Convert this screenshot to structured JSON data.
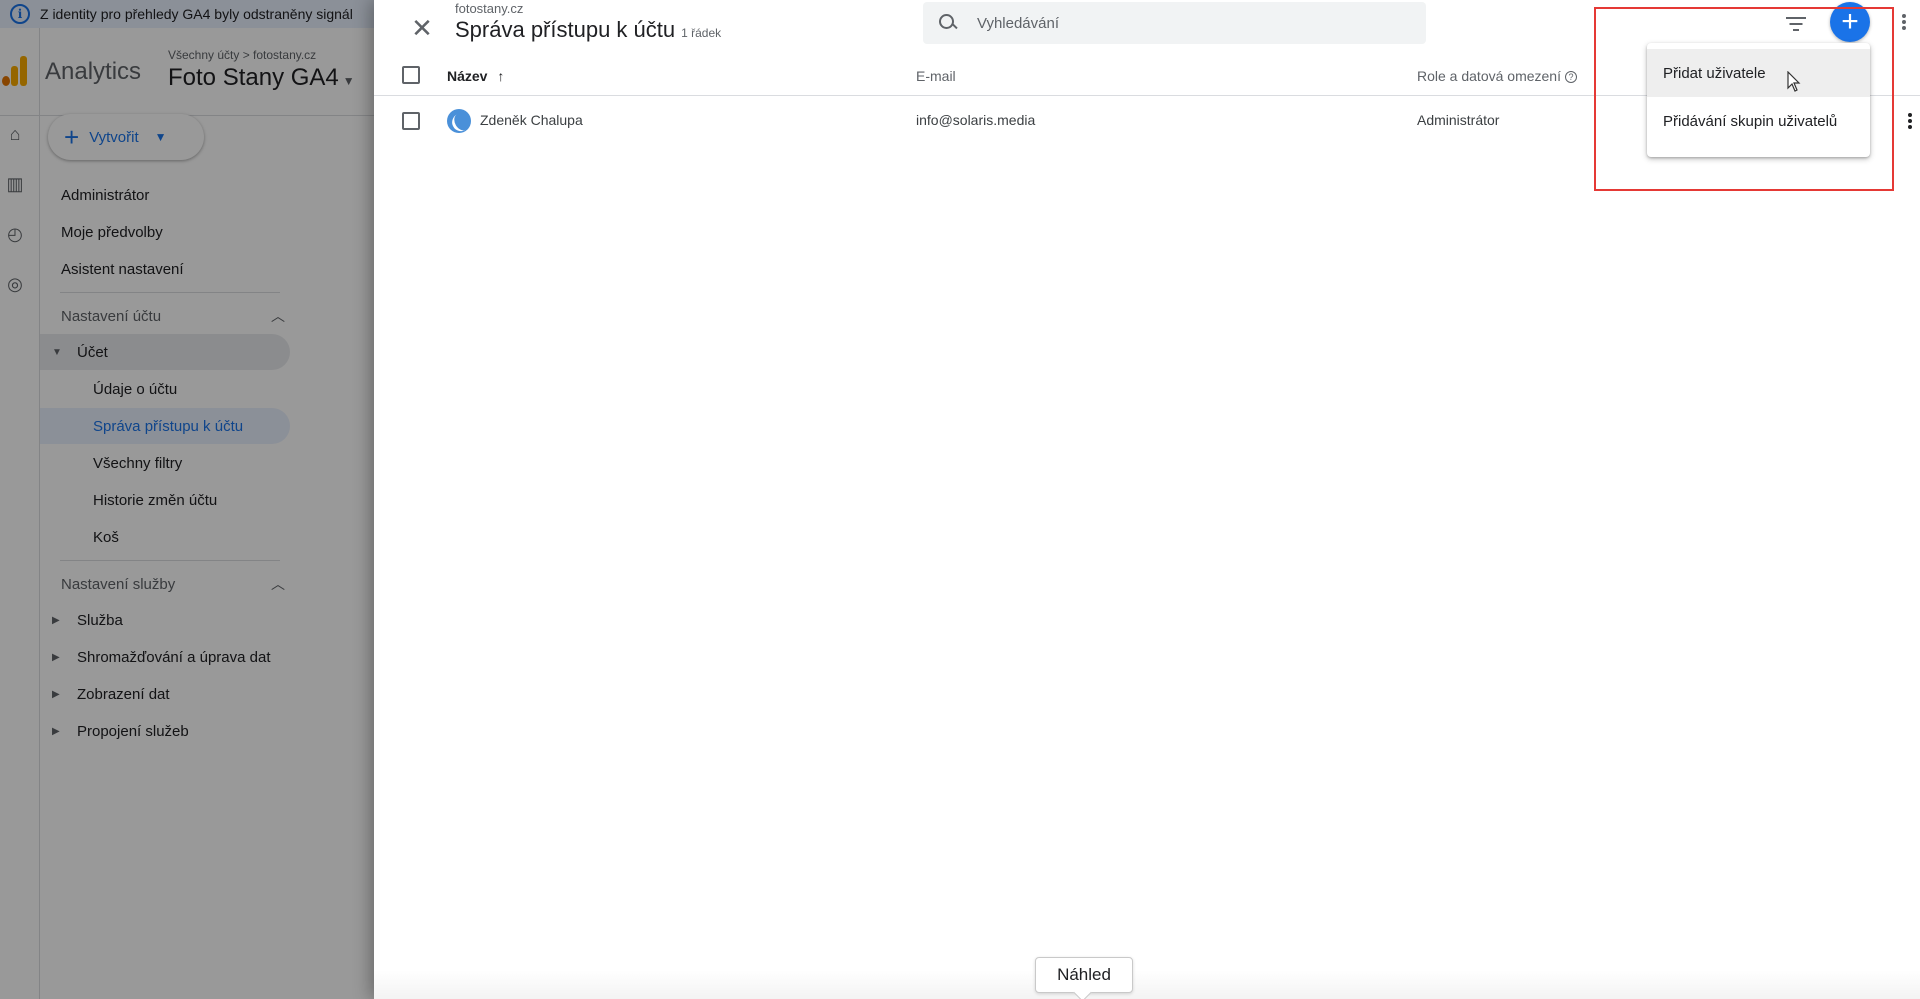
{
  "background": {
    "banner_text": "Z identity pro přehledy GA4 byly odstraněny signál",
    "app_name": "Analytics",
    "breadcrumb": "Všechny účty > fotostany.cz",
    "property_name": "Foto Stany GA4",
    "create_button": "Vytvořit",
    "sidebar": {
      "top_items": [
        "Administrátor",
        "Moje předvolby",
        "Asistent nastavení"
      ],
      "account_section": "Nastavení účtu",
      "account_group": "Účet",
      "account_items": [
        "Údaje o účtu",
        "Správa přístupu k účtu",
        "Všechny filtry",
        "Historie změn účtu",
        "Koš"
      ],
      "service_section": "Nastavení služby",
      "service_items": [
        "Služba",
        "Shromažďování a úprava dat",
        "Zobrazení dat",
        "Propojení služeb"
      ]
    }
  },
  "drawer": {
    "subtitle": "fotostany.cz",
    "title": "Správa přístupu k účtu",
    "row_count": "1 řádek",
    "search_placeholder": "Vyhledávání",
    "columns": {
      "name": "Název",
      "email": "E-mail",
      "role": "Role a datová omezení"
    },
    "rows": [
      {
        "name": "Zdeněk Chalupa",
        "email": "info@solaris.media",
        "role": "Administrátor"
      }
    ],
    "add_menu": [
      "Přidat uživatele",
      "Přidávání skupin uživatelů"
    ],
    "tooltip": "Náhled"
  },
  "colors": {
    "accent": "#1a73e8",
    "highlight_box": "#e53935"
  },
  "icons": {
    "close": "close-icon",
    "search": "search-icon",
    "filter": "filter-icon",
    "add": "add-icon",
    "more": "more-vert-icon"
  }
}
